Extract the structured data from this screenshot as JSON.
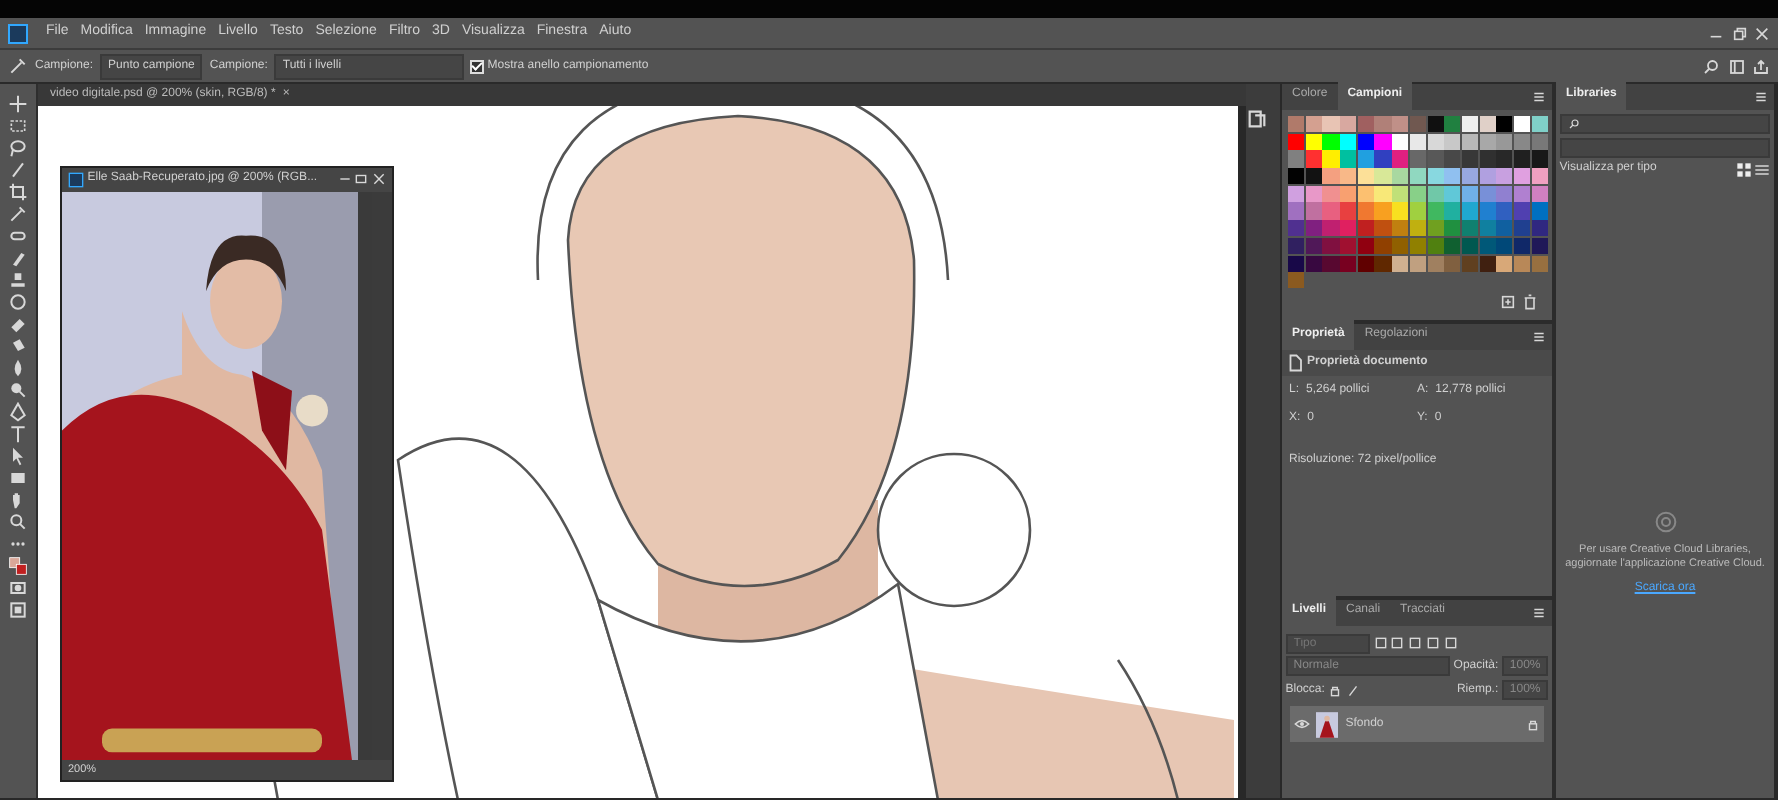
{
  "menu_bar": {
    "items": [
      "File",
      "Modifica",
      "Immagine",
      "Livello",
      "Testo",
      "Selezione",
      "Filtro",
      "3D",
      "Visualizza",
      "Finestra",
      "Aiuto"
    ]
  },
  "options_bar": {
    "sample_size_label": "Campione:",
    "sample_size": "Punto campione",
    "sample_label": "Campione:",
    "sample": "Tutti i livelli",
    "show_ring": {
      "label": "Mostra anello campionamento",
      "checked": true
    }
  },
  "document_tab": {
    "title": "video digitale.psd @ 200% (skin, RGB/8) *",
    "close": "×"
  },
  "floating_window": {
    "title": "Elle Saab-Recuperato.jpg @ 200% (RGB...",
    "zoom": "200%"
  },
  "color_panel": {
    "tabs": [
      {
        "label": "Colore",
        "selected": false
      },
      {
        "label": "Campioni",
        "selected": true
      }
    ],
    "swatches": [
      {
        "color": "#b07a6a"
      },
      {
        "color": "#d4a090"
      },
      {
        "color": "#e8c4b4"
      },
      {
        "color": "#d8a8a0"
      },
      {
        "color": "#a06060"
      },
      {
        "color": "#b08078"
      },
      {
        "color": "#c09088"
      },
      {
        "color": "#705850"
      },
      {
        "color": "#101010"
      },
      {
        "color": "#208040"
      },
      {
        "color": "#f0f0f0"
      },
      {
        "color": "#e0d0c8"
      },
      {
        "color": "#000000"
      },
      {
        "color": "#ffffff"
      },
      {
        "color": "#80d0c8"
      },
      {
        "color": "#ff0000"
      },
      {
        "color": "#ffff00"
      },
      {
        "color": "#00ff00"
      },
      {
        "color": "#00ffff"
      },
      {
        "color": "#0000ff"
      },
      {
        "color": "#ff00ff"
      },
      {
        "color": "#fefefe"
      },
      {
        "color": "#e8e8e8"
      },
      {
        "color": "#d8d8d8"
      },
      {
        "color": "#c8c8c8"
      },
      {
        "color": "#b8b8b8"
      },
      {
        "color": "#a8a8a8"
      },
      {
        "color": "#989898"
      },
      {
        "color": "#888888"
      },
      {
        "color": "#787878"
      },
      {
        "color": "#808080"
      },
      {
        "color": "#ff3030"
      },
      {
        "color": "#ffee00"
      },
      {
        "color": "#00c0a0"
      },
      {
        "color": "#20a0e0"
      },
      {
        "color": "#3040c0"
      },
      {
        "color": "#e02080"
      },
      {
        "color": "#686868"
      },
      {
        "color": "#585858"
      },
      {
        "color": "#484848"
      },
      {
        "color": "#383838"
      },
      {
        "color": "#303030"
      },
      {
        "color": "#282828"
      },
      {
        "color": "#202020"
      },
      {
        "color": "#181818"
      },
      {
        "color": "#020202"
      },
      {
        "color": "#121212"
      },
      {
        "color": "#f4a080"
      },
      {
        "color": "#f8b888"
      },
      {
        "color": "#fce098"
      },
      {
        "color": "#d8e898"
      },
      {
        "color": "#a8d8a0"
      },
      {
        "color": "#90d8c0"
      },
      {
        "color": "#88d8e0"
      },
      {
        "color": "#90c0f0"
      },
      {
        "color": "#98a8e0"
      },
      {
        "color": "#b0a0e0"
      },
      {
        "color": "#c8a0e0"
      },
      {
        "color": "#e0a0e0"
      },
      {
        "color": "#f0a0c0"
      },
      {
        "color": "#d0a0e0"
      },
      {
        "color": "#e898c8"
      },
      {
        "color": "#f09090"
      },
      {
        "color": "#f8a070"
      },
      {
        "color": "#fcc070"
      },
      {
        "color": "#f8e878"
      },
      {
        "color": "#c0e078"
      },
      {
        "color": "#88d088"
      },
      {
        "color": "#70c8a8"
      },
      {
        "color": "#60c8d8"
      },
      {
        "color": "#70b0e8"
      },
      {
        "color": "#7890d8"
      },
      {
        "color": "#9080d0"
      },
      {
        "color": "#b080d0"
      },
      {
        "color": "#d080c0"
      },
      {
        "color": "#a070c0"
      },
      {
        "color": "#c070a0"
      },
      {
        "color": "#e86080"
      },
      {
        "color": "#e84040"
      },
      {
        "color": "#f07830"
      },
      {
        "color": "#f8a020"
      },
      {
        "color": "#f8e020"
      },
      {
        "color": "#a0d040"
      },
      {
        "color": "#40b860"
      },
      {
        "color": "#20b0a0"
      },
      {
        "color": "#20a8d0"
      },
      {
        "color": "#2080d0"
      },
      {
        "color": "#3060c0"
      },
      {
        "color": "#5040b0"
      },
      {
        "color": "#0070c0"
      },
      {
        "color": "#503090"
      },
      {
        "color": "#802080"
      },
      {
        "color": "#c02070"
      },
      {
        "color": "#e02060"
      },
      {
        "color": "#c02020"
      },
      {
        "color": "#c05010"
      },
      {
        "color": "#c08010"
      },
      {
        "color": "#c0b010"
      },
      {
        "color": "#70a020"
      },
      {
        "color": "#209040"
      },
      {
        "color": "#108070"
      },
      {
        "color": "#1080a0"
      },
      {
        "color": "#1060a0"
      },
      {
        "color": "#204090"
      },
      {
        "color": "#302880"
      },
      {
        "color": "#302060"
      },
      {
        "color": "#501858"
      },
      {
        "color": "#801040"
      },
      {
        "color": "#a01030"
      },
      {
        "color": "#900010"
      },
      {
        "color": "#904000"
      },
      {
        "color": "#906000"
      },
      {
        "color": "#908000"
      },
      {
        "color": "#508010"
      },
      {
        "color": "#106030"
      },
      {
        "color": "#005850"
      },
      {
        "color": "#005878"
      },
      {
        "color": "#004878"
      },
      {
        "color": "#102868"
      },
      {
        "color": "#201858"
      },
      {
        "color": "#180848"
      },
      {
        "color": "#380840"
      },
      {
        "color": "#580830"
      },
      {
        "color": "#780020"
      },
      {
        "color": "#600000"
      },
      {
        "color": "#602800"
      },
      {
        "color": "#d0b090"
      },
      {
        "color": "#c0a080"
      },
      {
        "color": "#a08060"
      },
      {
        "color": "#806040"
      },
      {
        "color": "#604020"
      },
      {
        "color": "#402010"
      },
      {
        "color": "#d8a878"
      },
      {
        "color": "#b88858"
      },
      {
        "color": "#987040"
      },
      {
        "color": "#8b5a20"
      }
    ]
  },
  "properties_panel": {
    "tabs": [
      {
        "label": "Proprietà",
        "selected": true
      },
      {
        "label": "Regolazioni",
        "selected": false
      }
    ],
    "section": "Proprietà documento",
    "fields": [
      {
        "label": "L:",
        "value": "5,264 pollici"
      },
      {
        "label": "A:",
        "value": "12,778 pollici"
      },
      {
        "label": "X:",
        "value": "0"
      },
      {
        "label": "Y:",
        "value": "0"
      }
    ],
    "resolution": "Risoluzione: 72 pixel/pollice"
  },
  "layers_panel": {
    "tabs": [
      {
        "label": "Livelli",
        "selected": true
      },
      {
        "label": "Canali",
        "selected": false
      },
      {
        "label": "Tracciati",
        "selected": false
      }
    ],
    "filter": {
      "placeholder": "Tipo"
    },
    "blend_mode": "Normale",
    "opacity_label": "Opacità:",
    "opacity": "100%",
    "lock_label": "Blocca:",
    "fill_label": "Riemp.:",
    "fill": "100%",
    "layers": [
      {
        "name": "Sfondo",
        "visible": true,
        "locked": true
      }
    ]
  },
  "libraries_panel": {
    "tab": "Libraries",
    "view_label": "Visualizza per tipo",
    "message": "Per usare Creative Cloud Libraries, aggiornate l'applicazione Creative Cloud.",
    "link": "Scarica ora"
  }
}
